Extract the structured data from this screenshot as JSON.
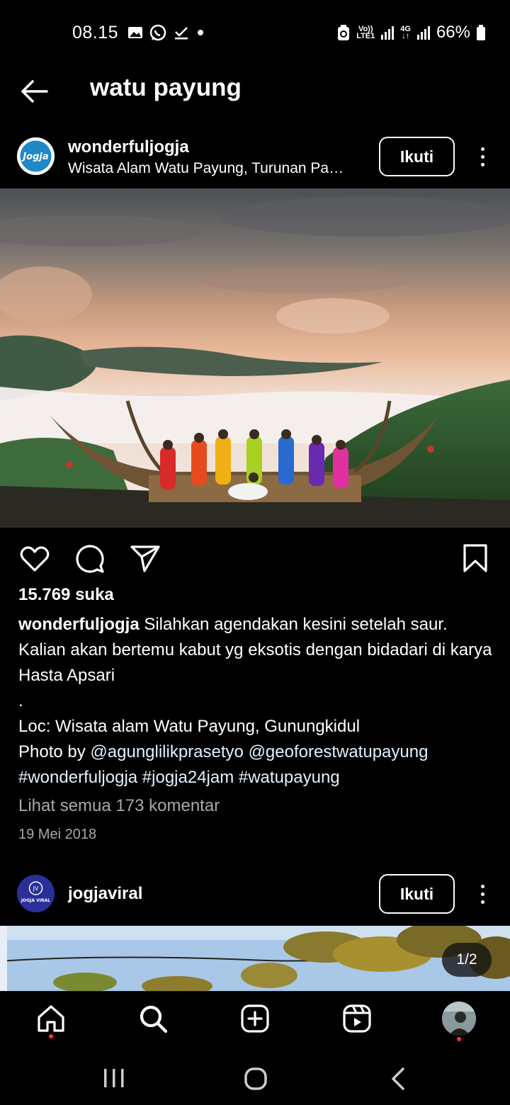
{
  "status_bar": {
    "time": "08.15",
    "network_1": "Vo))\nLTE1",
    "network_2": "4G",
    "battery": "66%",
    "icons": [
      "gallery-icon",
      "whatsapp-icon",
      "download-done-icon",
      "dot-icon",
      "recycle-icon",
      "signal-icon",
      "battery-icon"
    ]
  },
  "header": {
    "title": "watu payung",
    "back_icon": "arrow-left-icon"
  },
  "post1": {
    "username": "wonderfuljogja",
    "location": "Wisata Alam Watu Payung, Turunan Pa…",
    "avatar_text": "Jogja",
    "follow_label": "Ikuti",
    "likes": "15.769 suka",
    "caption_user": "wonderfuljogja",
    "caption_text": " Silahkan agendakan kesini setelah saur. Kalian akan bertemu kabut yg eksotis dengan bidadari di karya Hasta Apsari",
    "caption_dot": ".",
    "caption_loc": "Loc: Wisata alam Watu Payung, Gunungkidul",
    "caption_photo_prefix": "Photo by ",
    "caption_mention_1": "@agunglilikprasetyo",
    "caption_mention_2": "@geoforestwatupayung",
    "caption_hashtags": "#wonderfuljogja #jogja24jam #watupayung",
    "comments_link": "Lihat semua 173 komentar",
    "date": "19 Mei 2018"
  },
  "post2": {
    "username": "jogjaviral",
    "avatar_text": "JOGJA VIRAL",
    "avatar_mark": "JV",
    "follow_label": "Ikuti",
    "counter": "1/2"
  },
  "colors": {
    "background": "#000000",
    "text": "#ffffff",
    "muted": "#a8a8a8",
    "notification": "#ff3040",
    "jogja_avatar_blue": "#1e88c8",
    "jogjaviral_avatar": "#2a2f9a"
  }
}
